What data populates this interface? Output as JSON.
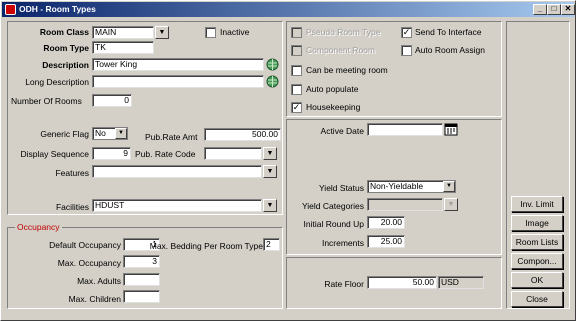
{
  "window": {
    "title": "ODH - Room Types",
    "minimize": "_",
    "maximize": "□",
    "close": "✕"
  },
  "form": {
    "room_class": {
      "label": "Room Class",
      "value": "MAIN"
    },
    "inactive": {
      "label": "Inactive",
      "checked": false
    },
    "room_type": {
      "label": "Room Type",
      "value": "TK"
    },
    "description": {
      "label": "Description",
      "value": "Tower King"
    },
    "long_description": {
      "label": "Long Description",
      "value": ""
    },
    "number_of_rooms": {
      "label": "Number Of Rooms",
      "value": "0"
    },
    "generic_flag": {
      "label": "Generic Flag",
      "value": "No"
    },
    "pub_rate_amt": {
      "label": "Pub.Rate Amt",
      "value": "500.00"
    },
    "display_sequence": {
      "label": "Display Sequence",
      "value": "9"
    },
    "pub_rate_code": {
      "label": "Pub. Rate Code",
      "value": ""
    },
    "features": {
      "label": "Features",
      "value": ""
    },
    "facilities": {
      "label": "Facilities",
      "value": "HDUST"
    }
  },
  "occupancy": {
    "title": "Occupancy",
    "default_occupancy": {
      "label": "Default Occupancy",
      "value": "1"
    },
    "max_bedding": {
      "label": "Max. Bedding Per Room Type",
      "value": "2"
    },
    "max_occupancy": {
      "label": "Max. Occupancy",
      "value": "3"
    },
    "max_adults": {
      "label": "Max. Adults",
      "value": ""
    },
    "max_children": {
      "label": "Max. Children",
      "value": ""
    }
  },
  "flags": {
    "pseudo_room_type": {
      "label": "Pseudo Room Type",
      "checked": false,
      "disabled": true
    },
    "send_to_interface": {
      "label": "Send To Interface",
      "checked": true
    },
    "component_room": {
      "label": "Component Room",
      "checked": false,
      "disabled": true
    },
    "auto_room_assign": {
      "label": "Auto Room Assign",
      "checked": false
    },
    "can_be_meeting_room": {
      "label": "Can be meeting room",
      "checked": false
    },
    "auto_populate": {
      "label": "Auto populate",
      "checked": false
    },
    "housekeeping": {
      "label": "Housekeeping",
      "checked": true
    }
  },
  "yield": {
    "active_date": {
      "label": "Active Date",
      "value": ""
    },
    "yield_status": {
      "label": "Yield Status",
      "value": "Non-Yieldable"
    },
    "yield_categories": {
      "label": "Yield Categories",
      "value": ""
    },
    "initial_round_up": {
      "label": "Initial Round Up",
      "value": "20.00"
    },
    "increments": {
      "label": "Increments",
      "value": "25.00"
    }
  },
  "rate_floor": {
    "label": "Rate Floor",
    "value": "50.00",
    "currency": "USD"
  },
  "buttons": {
    "inv_limit": "Inv. Limit",
    "image": "Image",
    "room_lists": "Room Lists",
    "component": "Compon...",
    "ok": "OK",
    "close": "Close"
  },
  "icons": {
    "dropdown": "▼",
    "check": "✓"
  }
}
